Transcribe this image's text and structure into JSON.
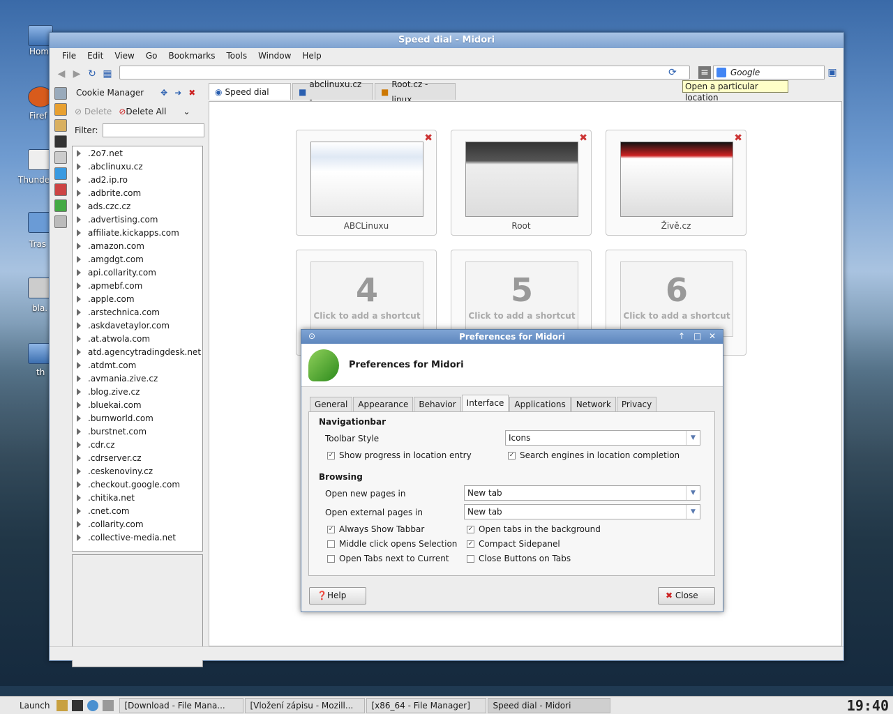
{
  "desktop": {
    "icons": [
      "Hom",
      "Firef",
      "Thunde",
      "Tras",
      "bla.",
      "th"
    ]
  },
  "window": {
    "title": "Speed dial - Midori"
  },
  "menu": [
    "File",
    "Edit",
    "View",
    "Go",
    "Bookmarks",
    "Tools",
    "Window",
    "Help"
  ],
  "search": {
    "engine": "Google"
  },
  "tooltip": "Open a particular location",
  "cookie_manager": {
    "title": "Cookie Manager",
    "delete_label": "Delete",
    "delete_all_label": "Delete All",
    "filter_label": "Filter:",
    "domains": [
      ".2o7.net",
      ".abclinuxu.cz",
      ".ad2.ip.ro",
      ".adbrite.com",
      "ads.czc.cz",
      ".advertising.com",
      "affiliate.kickapps.com",
      ".amazon.com",
      ".amgdgt.com",
      "api.collarity.com",
      ".apmebf.com",
      ".apple.com",
      ".arstechnica.com",
      ".askdavetaylor.com",
      ".at.atwola.com",
      "atd.agencytradingdesk.net",
      ".atdmt.com",
      ".avmania.zive.cz",
      ".blog.zive.cz",
      ".bluekai.com",
      ".burnworld.com",
      ".burstnet.com",
      ".cdr.cz",
      ".cdrserver.cz",
      ".ceskenoviny.cz",
      ".checkout.google.com",
      ".chitika.net",
      ".cnet.com",
      ".collarity.com",
      ".collective-media.net"
    ]
  },
  "tabs": [
    "Speed dial",
    "abclinuxu.cz -...",
    "Root.cz - linux..."
  ],
  "speed_dial": {
    "filled": [
      {
        "label": "ABCLinuxu"
      },
      {
        "label": "Root"
      },
      {
        "label": "Živě.cz"
      }
    ],
    "empty": [
      {
        "number": "4",
        "text": "Click to add a shortcut"
      },
      {
        "number": "5",
        "text": "Click to add a shortcut"
      },
      {
        "number": "6",
        "text": "Click to add a shortcut"
      }
    ]
  },
  "dialog": {
    "title": "Preferences for Midori",
    "heading": "Preferences for Midori",
    "tabs": [
      "General",
      "Appearance",
      "Behavior",
      "Interface",
      "Applications",
      "Network",
      "Privacy"
    ],
    "active_tab": "Interface",
    "nav_section": "Navigationbar",
    "toolbar_style_label": "Toolbar Style",
    "toolbar_style_value": "Icons",
    "show_progress": "Show progress in location entry",
    "search_engines": "Search engines in location completion",
    "browsing_section": "Browsing",
    "open_new_label": "Open new pages in",
    "open_new_value": "New tab",
    "open_ext_label": "Open external pages in",
    "open_ext_value": "New tab",
    "always_tabbar": "Always Show Tabbar",
    "open_bg": "Open tabs in the background",
    "middle_click": "Middle click opens Selection",
    "compact_side": "Compact Sidepanel",
    "tabs_next": "Open Tabs next to Current",
    "close_buttons": "Close Buttons on Tabs",
    "help_label": "Help",
    "close_label": "Close"
  },
  "taskbar": {
    "launch": "Launch",
    "items": [
      "[Download - File Mana...",
      "[Vložení zápisu - Mozill...",
      "[x86_64 - File Manager]",
      "Speed dial - Midori"
    ],
    "clock": "19:40"
  }
}
